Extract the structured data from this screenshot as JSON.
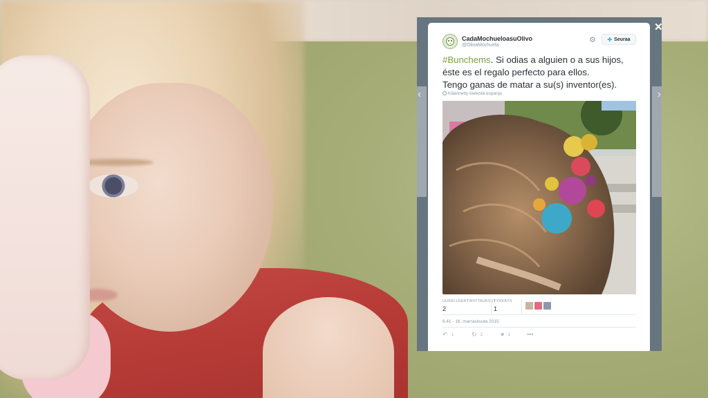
{
  "tweet": {
    "user_name": "CadaMochueloasuOlivo",
    "handle": "@OlivaMochuela",
    "follow_label": "Seuraa",
    "text_hashtag": "#Bunchems",
    "text_rest_line1": ". Si odias a alguien o a sus hijos,",
    "text_line2": "éste es el regalo perfecto para ellos.",
    "text_line3": "Tengo ganas de matar a su(s) inventor(es).",
    "translated_note": "Käännetty kielestä espanja",
    "retweets_label": "UUDELLEENTWIITTAUKSET",
    "retweets_count": "2",
    "likes_label": "TYKKÄYS",
    "likes_count": "1",
    "timestamp": "6.41 - 16. marraskuuta 2015",
    "reply_count": "1",
    "retweet_count": "2",
    "like_count": "1",
    "more_icon": "more-dots-icon"
  },
  "modal": {
    "close_icon": "close-icon",
    "prev_icon": "chevron-left-icon",
    "next_icon": "chevron-right-icon"
  },
  "colors": {
    "hashtag": "#79a13c",
    "follow_icon": "#55acee",
    "overlay": "#66757f"
  }
}
